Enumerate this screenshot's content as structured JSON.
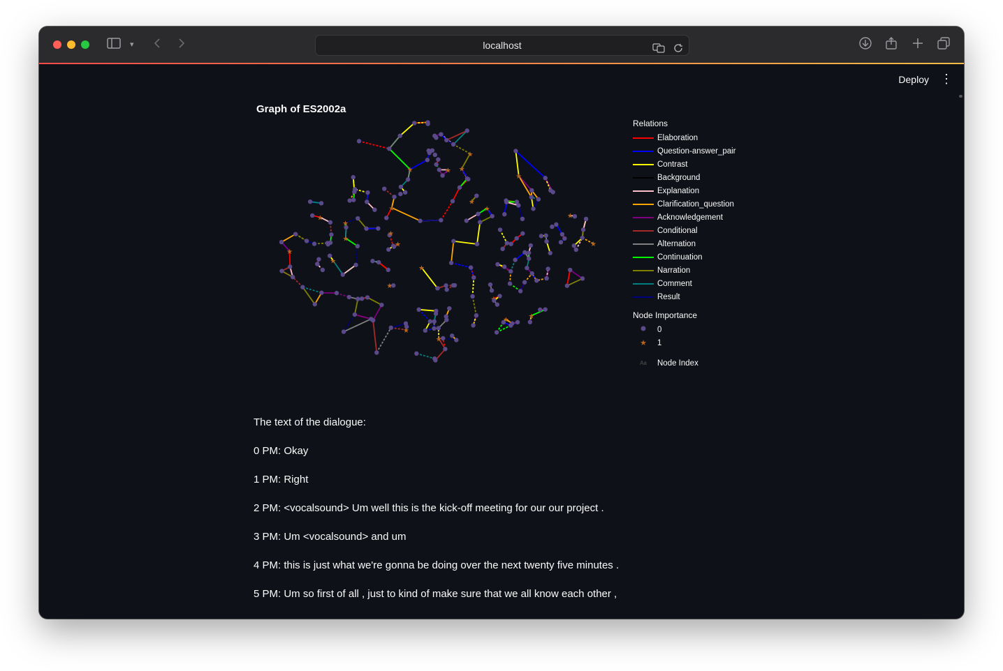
{
  "browser": {
    "url": "localhost",
    "nav": {
      "back_icon": "chevron-left-icon",
      "forward_icon": "chevron-right-icon"
    },
    "toolbar_icons": [
      "sidebar-icon",
      "download-icon",
      "share-icon",
      "new-tab-icon",
      "tabs-overview-icon"
    ]
  },
  "app": {
    "deploy_label": "Deploy",
    "menu_icon": "vertical-dots-icon"
  },
  "graph": {
    "title": "Graph of ES2002a",
    "legend": {
      "relations_title": "Relations",
      "relations": [
        {
          "label": "Elaboration",
          "color": "#ff0000"
        },
        {
          "label": "Question-answer_pair",
          "color": "#0000ff"
        },
        {
          "label": "Contrast",
          "color": "#ffff00"
        },
        {
          "label": "Background",
          "color": "#000000"
        },
        {
          "label": "Explanation",
          "color": "#ffc0cb"
        },
        {
          "label": "Clarification_question",
          "color": "#ffa500"
        },
        {
          "label": "Acknowledgement",
          "color": "#800080"
        },
        {
          "label": "Conditional",
          "color": "#a52a2a"
        },
        {
          "label": "Alternation",
          "color": "#808080"
        },
        {
          "label": "Continuation",
          "color": "#00ff00"
        },
        {
          "label": "Narration",
          "color": "#808000"
        },
        {
          "label": "Comment",
          "color": "#008080"
        },
        {
          "label": "Result",
          "color": "#000080"
        }
      ],
      "importance_title": "Node Importance",
      "importance": [
        {
          "label": "0",
          "marker": "circle",
          "color": "#5a4a8a"
        },
        {
          "label": "1",
          "marker": "star",
          "color": "#b5651d"
        }
      ],
      "index_marker": "Aa",
      "index_label": "Node Index"
    }
  },
  "dialogue": {
    "heading": "The text of the dialogue:",
    "lines": [
      "0 PM: Okay",
      "1 PM: Right",
      "2 PM: <vocalsound> Um well this is the kick-off meeting for our our project .",
      "3 PM: Um <vocalsound> and um",
      "4 PM: this is just what we're gonna be doing over the next twenty five minutes .",
      "5 PM: Um so first of all , just to kind of make sure that we all know each other ,"
    ]
  }
}
